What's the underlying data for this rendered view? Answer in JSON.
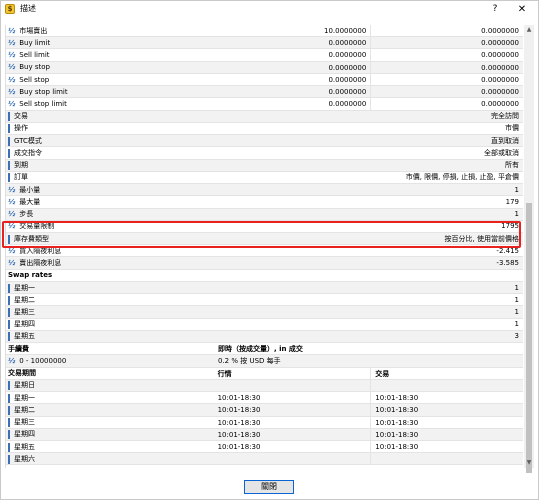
{
  "window": {
    "title": "描述",
    "help_label": "?",
    "close_symbol": "✕",
    "app_icon_glyph": "$",
    "close_button_label": "關閉"
  },
  "rows_top": [
    {
      "icon": "half-icon",
      "label": "市場賣出",
      "v1": "10.0000000",
      "v2": "0.0000000"
    },
    {
      "icon": "half-icon",
      "label": "Buy limit",
      "v1": "0.0000000",
      "v2": "0.0000000"
    },
    {
      "icon": "half-icon",
      "label": "Sell limit",
      "v1": "0.0000000",
      "v2": "0.0000000"
    },
    {
      "icon": "half-icon",
      "label": "Buy stop",
      "v1": "0.0000000",
      "v2": "0.0000000"
    },
    {
      "icon": "half-icon",
      "label": "Sell stop",
      "v1": "0.0000000",
      "v2": "0.0000000"
    },
    {
      "icon": "half-icon",
      "label": "Buy stop limit",
      "v1": "0.0000000",
      "v2": "0.0000000"
    },
    {
      "icon": "half-icon",
      "label": "Sell stop limit",
      "v1": "0.0000000",
      "v2": "0.0000000"
    }
  ],
  "rows_props": [
    {
      "icon": "list-icon",
      "label": "交易",
      "value": "完全訪問"
    },
    {
      "icon": "list-icon",
      "label": "操作",
      "value": "市價"
    },
    {
      "icon": "list-icon",
      "label": "GTC模式",
      "value": "直到取消"
    },
    {
      "icon": "list-icon",
      "label": "成交指令",
      "value": "全部或取消"
    },
    {
      "icon": "list-icon",
      "label": "到期",
      "value": "所有"
    },
    {
      "icon": "list-icon",
      "label": "訂單",
      "value": "市價, 限價, 停損, 止損, 止盈, 平倉價"
    },
    {
      "icon": "half-icon",
      "label": "最小量",
      "value": "1"
    },
    {
      "icon": "half-icon",
      "label": "最大量",
      "value": "179"
    },
    {
      "icon": "half-icon",
      "label": "步長",
      "value": "1"
    },
    {
      "icon": "half-icon",
      "label": "交易量限制",
      "value": "1795"
    },
    {
      "icon": "list-icon",
      "label": "庫存費類型",
      "value": "按百分比, 使用當前價格"
    },
    {
      "icon": "half-icon",
      "label": "買入隔夜利息",
      "value": "-2.415"
    },
    {
      "icon": "half-icon",
      "label": "賣出隔夜利息",
      "value": "-3.585"
    }
  ],
  "swap_section": {
    "title": "Swap rates",
    "rows": [
      {
        "label": "星期一",
        "value": "1"
      },
      {
        "label": "星期二",
        "value": "1"
      },
      {
        "label": "星期三",
        "value": "1"
      },
      {
        "label": "星期四",
        "value": "1"
      },
      {
        "label": "星期五",
        "value": "3"
      }
    ]
  },
  "fee_section": {
    "title": "手續費",
    "header2": "即時（按成交量）, in 成交",
    "row": {
      "label": "0 - 10000000",
      "value": "0.2 % 按 USD 每手"
    }
  },
  "sessions_section": {
    "title": "交易期間",
    "col2": "行情",
    "col3": "交易",
    "rows": [
      {
        "label": "星期日",
        "q": "",
        "t": ""
      },
      {
        "label": "星期一",
        "q": "10:01-18:30",
        "t": "10:01-18:30"
      },
      {
        "label": "星期二",
        "q": "10:01-18:30",
        "t": "10:01-18:30"
      },
      {
        "label": "星期三",
        "q": "10:01-18:30",
        "t": "10:01-18:30"
      },
      {
        "label": "星期四",
        "q": "10:01-18:30",
        "t": "10:01-18:30"
      },
      {
        "label": "星期五",
        "q": "10:01-18:30",
        "t": "10:01-18:30"
      },
      {
        "label": "星期六",
        "q": "",
        "t": ""
      }
    ]
  },
  "colors": {
    "highlight": "#e8231f",
    "accent": "#0a64d2"
  }
}
